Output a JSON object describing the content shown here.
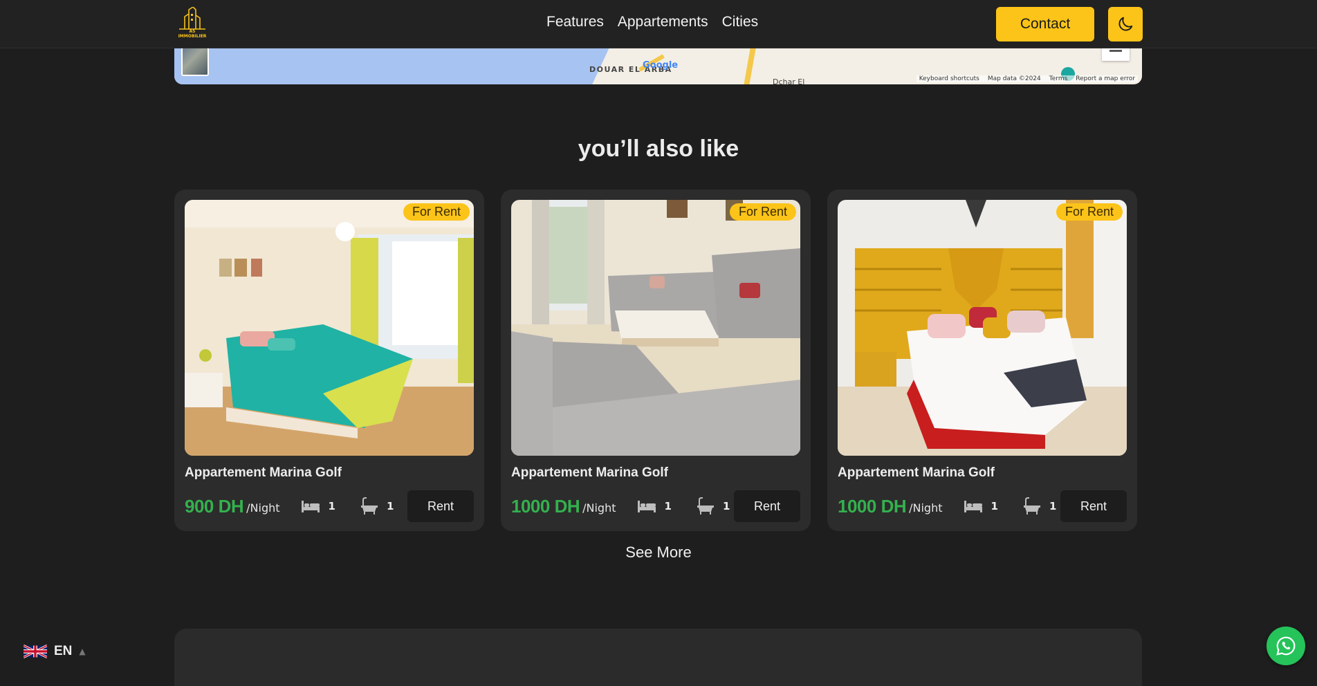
{
  "brand": {
    "logo_text": "AS IMMOBILIER",
    "accent_color": "#fcc419"
  },
  "nav": {
    "links": [
      "Features",
      "Appartements",
      "Cities"
    ],
    "contact_label": "Contact",
    "theme_icon": "moon-icon"
  },
  "map": {
    "place_label": "DOUAR EL ARBA",
    "place_label_2": "Dchar El",
    "google_label": "Google",
    "attribution": [
      "Keyboard shortcuts",
      "Map data ©2024",
      "Terms",
      "Report a map error"
    ]
  },
  "section": {
    "title": "you’ll also like",
    "see_more_label": "See More"
  },
  "listings": [
    {
      "badge": "For Rent",
      "title": "Appartement Marina Golf",
      "price": "900 DH",
      "unit": "/Night",
      "beds": "1",
      "baths": "1",
      "action": "Rent",
      "photo": "bedroom-teal-bed"
    },
    {
      "badge": "For Rent",
      "title": "Appartement Marina Golf",
      "price": "1000 DH",
      "unit": "/Night",
      "beds": "1",
      "baths": "1",
      "action": "Rent",
      "photo": "living-room-grey-sofa"
    },
    {
      "badge": "For Rent",
      "title": "Appartement Marina Golf",
      "price": "1000 DH",
      "unit": "/Night",
      "beds": "1",
      "baths": "1",
      "action": "Rent",
      "photo": "bedroom-yellow-headboard"
    }
  ],
  "language": {
    "code": "EN",
    "flag_icon": "uk-flag-icon"
  },
  "whatsapp_icon": "whatsapp-icon",
  "colors": {
    "price_green": "#34b14e",
    "background": "#1e1e1e",
    "card": "#2c2c2c"
  }
}
